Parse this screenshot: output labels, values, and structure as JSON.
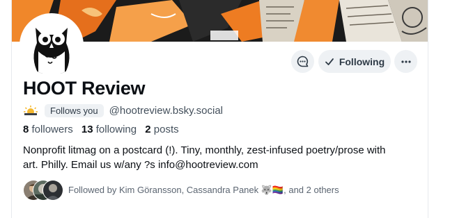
{
  "profile": {
    "display_name": "HOOT Review",
    "follows_you_label": "Follows you",
    "handle": "@hootreview.bsky.social",
    "badge_icon": "sun-cloud-icon",
    "avatar_icon": "owl-icon"
  },
  "actions": {
    "message_icon": "chat-bubble-icon",
    "following_label": "Following",
    "following_icon": "checkmark-icon",
    "more_icon": "ellipsis-icon"
  },
  "stats": {
    "followers_count": "8",
    "followers_label": "followers",
    "following_count": "13",
    "following_label": "following",
    "posts_count": "2",
    "posts_label": "posts"
  },
  "bio": {
    "line1": "Nonprofit litmag on a postcard (!). Tiny, monthly, zest-infused poetry/prose with",
    "line2": "art. Philly. Email us w/any ?s info@hootreview.com"
  },
  "followed_by": {
    "text": "Followed by Kim Göransson, Cassandra Panek 🐺🏳️‍🌈, and 2 others"
  },
  "colors": {
    "banner_orange": "#f0872a",
    "banner_dark": "#1b1b1b",
    "button_bg": "#eef1f4",
    "text_primary": "#0b0f14",
    "text_secondary": "#44505c"
  }
}
